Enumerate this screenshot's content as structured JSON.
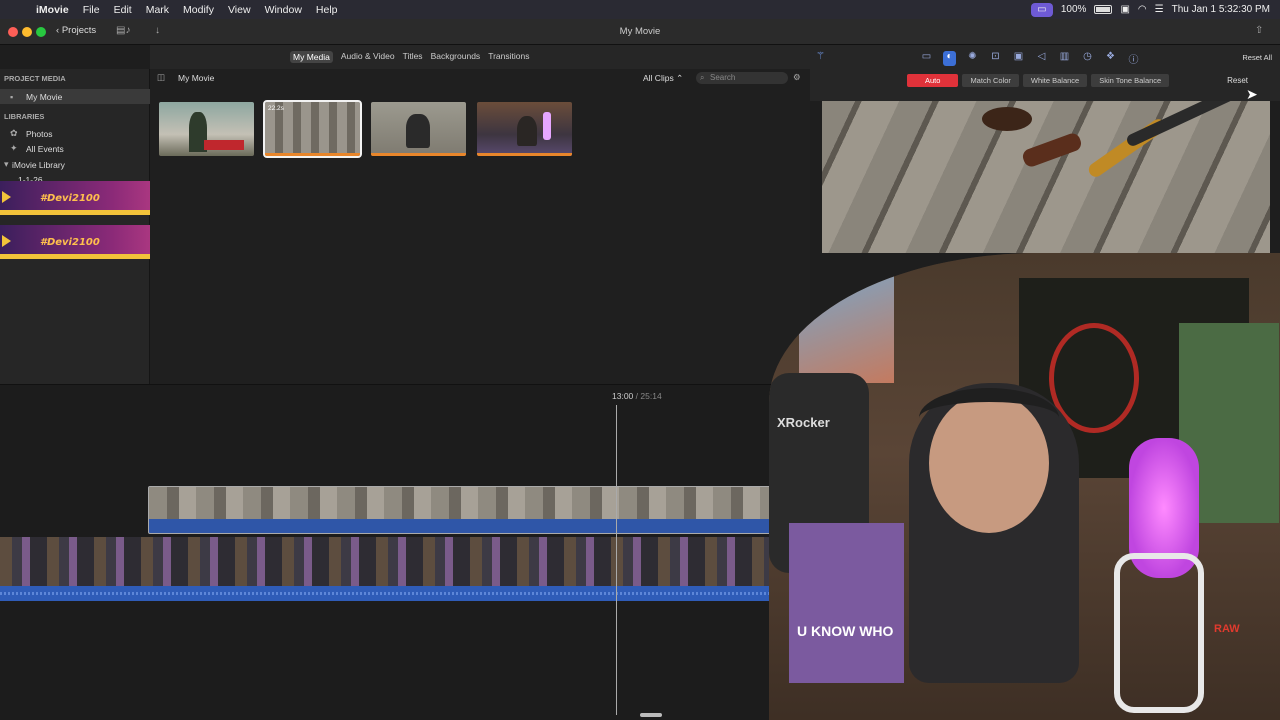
{
  "menubar": {
    "app_name": "iMovie",
    "items": [
      "File",
      "Edit",
      "Mark",
      "Modify",
      "View",
      "Window",
      "Help"
    ],
    "battery": "100%",
    "clock": "Thu Jan 1  5:32:30 PM"
  },
  "window": {
    "projects_label": "Projects",
    "title": "My Movie"
  },
  "media_tabs": [
    "My Media",
    "Audio & Video",
    "Titles",
    "Backgrounds",
    "Transitions"
  ],
  "sidebar": {
    "project_media_header": "PROJECT MEDIA",
    "project_item": "My Movie",
    "libraries_header": "LIBRARIES",
    "photos": "Photos",
    "all_events": "All Events",
    "imovie_library": "iMovie Library",
    "event": "1-1-26"
  },
  "lower_thirds": [
    {
      "label": "#Devi2100"
    },
    {
      "label": "#Devi2100"
    }
  ],
  "browser": {
    "title": "My Movie",
    "filter": "All Clips",
    "search_placeholder": "Search",
    "selected_thumb_duration": "22.2s"
  },
  "inspector": {
    "reset_all": "Reset All",
    "reset": "Reset",
    "color_buttons": [
      "Auto",
      "Match Color",
      "White Balance",
      "Skin Tone Balance"
    ]
  },
  "timeline": {
    "current_time": "13:00",
    "separator": "/",
    "total_time": "25:14"
  },
  "webcam": {
    "chair_brand": "XRocker",
    "box_text": "U KNOW WHO",
    "shelf_text": "RAW"
  },
  "colors": {
    "accent_red": "#e0323a",
    "selection_blue": "#3c6fd6",
    "audio_blue": "#2f5cb8",
    "lower_third_gold": "#f2c33a"
  }
}
